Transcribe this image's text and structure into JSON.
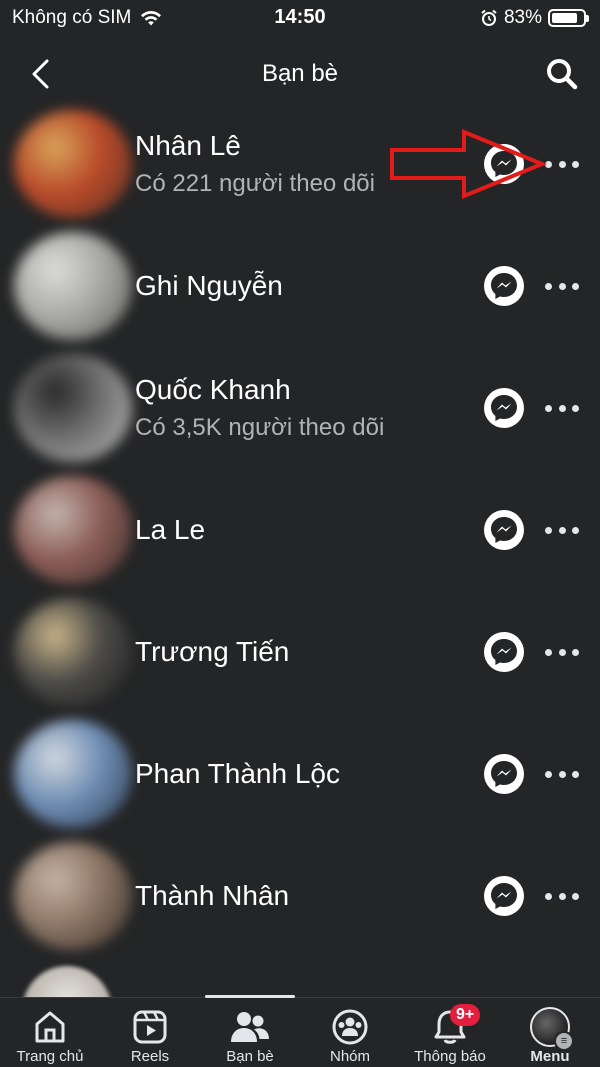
{
  "status": {
    "carrier": "Không có SIM",
    "time": "14:50",
    "battery": "83%",
    "battery_level": 0.83
  },
  "header": {
    "title": "Bạn bè"
  },
  "friends": [
    {
      "name": "Nhân Lê",
      "subtitle": "Có 221 người theo dõi",
      "avatar_colors": [
        "#b84a2a",
        "#d9a35a",
        "#5a3324"
      ]
    },
    {
      "name": "Ghi Nguyễn",
      "subtitle": "",
      "avatar_colors": [
        "#a9a9a5",
        "#dcdcd8",
        "#5e5e5a"
      ]
    },
    {
      "name": "Quốc Khanh",
      "subtitle": "Có 3,5K người theo dõi",
      "avatar_colors": [
        "#707070",
        "#2a2a2a",
        "#bcbcbc"
      ]
    },
    {
      "name": "La Le",
      "subtitle": "",
      "avatar_colors": [
        "#8c5d57",
        "#c4b4ae",
        "#3c2e2c"
      ]
    },
    {
      "name": "Trương Tiến",
      "subtitle": "",
      "avatar_colors": [
        "#4b4a46",
        "#c9b48a",
        "#1f1f23"
      ]
    },
    {
      "name": "Phan Thành Lộc",
      "subtitle": "",
      "avatar_colors": [
        "#6e8db3",
        "#d2d8df",
        "#2d3a4f"
      ]
    },
    {
      "name": "Thành Nhân",
      "subtitle": "",
      "avatar_colors": [
        "#8a7565",
        "#c7b3a3",
        "#3a2f28"
      ]
    }
  ],
  "bottom_nav": [
    {
      "label": "Trang chủ",
      "icon": "home-icon"
    },
    {
      "label": "Reels",
      "icon": "reels-icon"
    },
    {
      "label": "Bạn bè",
      "icon": "friends-icon",
      "active": true
    },
    {
      "label": "Nhóm",
      "icon": "groups-icon"
    },
    {
      "label": "Thông báo",
      "icon": "bell-icon",
      "badge": "9+"
    },
    {
      "label": "Menu",
      "icon": "menu-avatar"
    }
  ],
  "colors": {
    "background": "#242526",
    "text": "#e4e6eb",
    "subtext": "#b0b3b8",
    "badge": "#e41e3f",
    "annotation": "#e31b1b"
  }
}
